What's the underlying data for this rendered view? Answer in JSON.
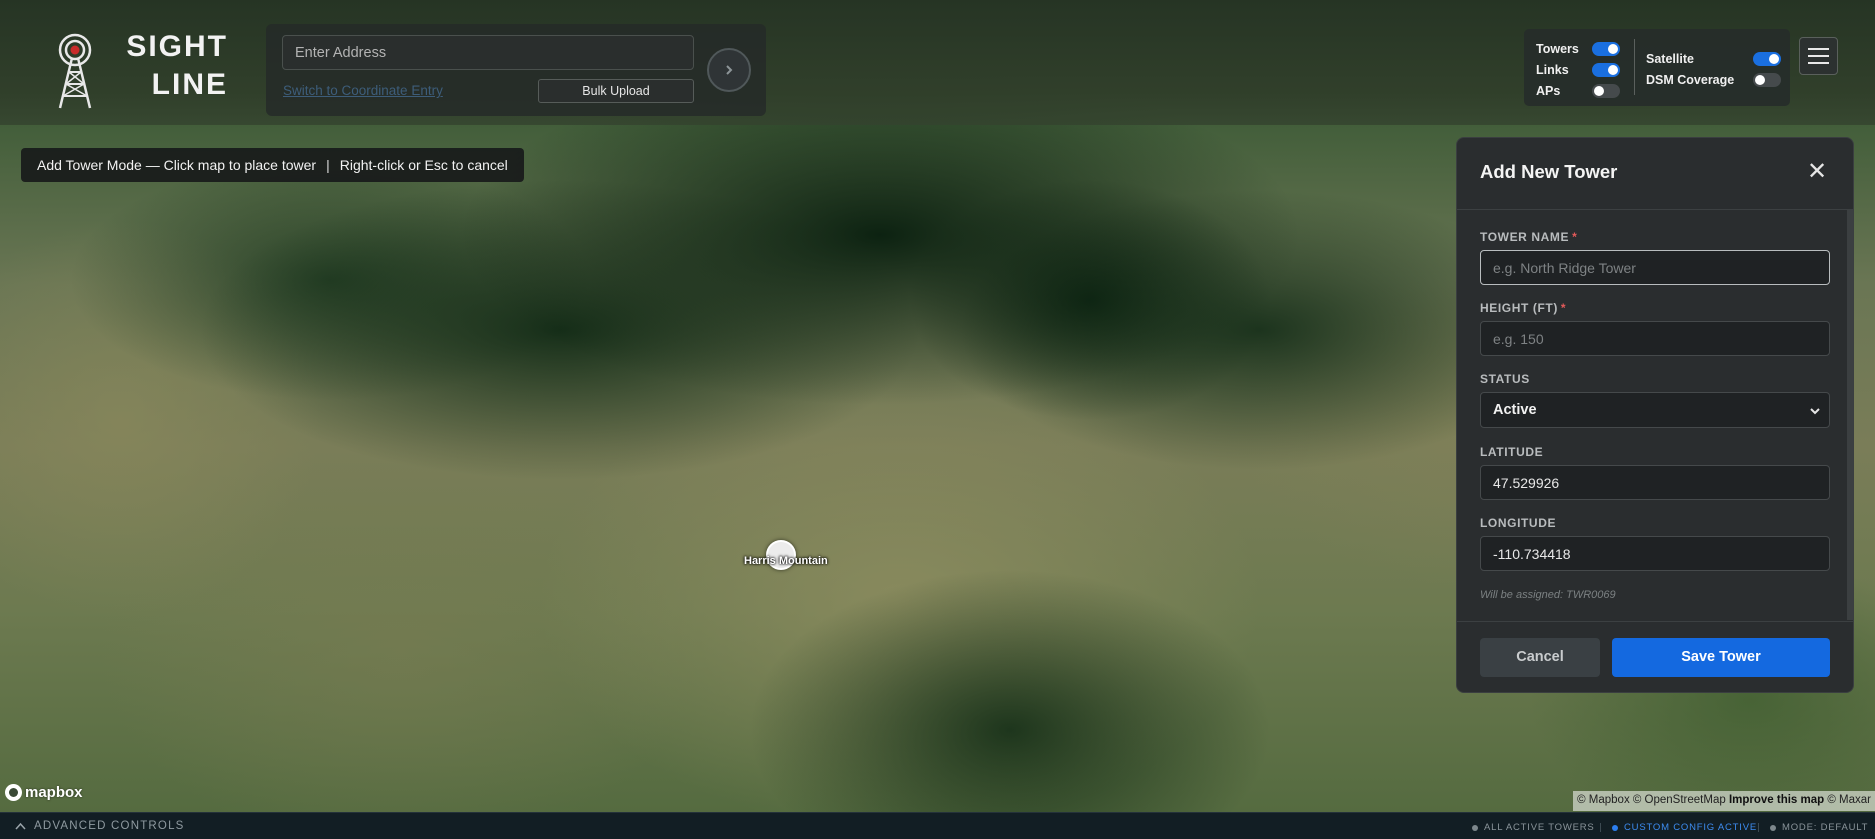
{
  "app": {
    "logo_text_line1": "SIGHT",
    "logo_text_line2": "LINE",
    "logo_icon": "radio-tower-icon"
  },
  "search": {
    "address_placeholder": "Enter Address",
    "go_icon": "chevron-right-icon",
    "coordinate_link": "Switch to Coordinate Entry",
    "bulk_upload_label": "Bulk Upload"
  },
  "layers": {
    "left": [
      {
        "label": "Towers",
        "on": true
      },
      {
        "label": "Links",
        "on": true
      },
      {
        "label": "APs",
        "on": false
      }
    ],
    "right": [
      {
        "label": "Satellite",
        "on": true
      },
      {
        "label": "DSM Coverage",
        "on": false
      }
    ],
    "menu_icon": "hamburger-menu-icon"
  },
  "mode_banner": {
    "left": "Add Tower Mode — Click map to place tower",
    "separator": "|",
    "right": "Right-click or Esc to cancel"
  },
  "map": {
    "tower_label": "Harris Mountain",
    "mapbox_logo": "mapbox",
    "attribution_prefix": "© Mapbox © OpenStreetMap",
    "attribution_improve": "Improve this map",
    "attribution_suffix": "© Maxar"
  },
  "tower_form": {
    "title": "Add New Tower",
    "close_icon": "close-icon",
    "name_label": "TOWER NAME",
    "name_placeholder": "e.g. North Ridge Tower",
    "height_label": "HEIGHT (FT)",
    "height_placeholder": "e.g. 150",
    "required_mark": "*",
    "status_label": "STATUS",
    "status_value": "Active",
    "latitude_label": "LATITUDE",
    "latitude_value": "47.529926",
    "longitude_label": "LONGITUDE",
    "longitude_value": "-110.734418",
    "assign_note": "Will be assigned: TWR0069",
    "cancel_label": "Cancel",
    "save_label": "Save Tower"
  },
  "bottom_bar": {
    "advanced_controls": "ADVANCED CONTROLS",
    "status_all_towers": "ALL ACTIVE TOWERS",
    "status_custom_config": "CUSTOM CONFIG ACTIVE",
    "status_mode": "MODE: DEFAULT"
  },
  "colors": {
    "accent_blue": "#1469e0",
    "required_red": "#e45a5a",
    "panel_bg": "#2a2d2f"
  }
}
